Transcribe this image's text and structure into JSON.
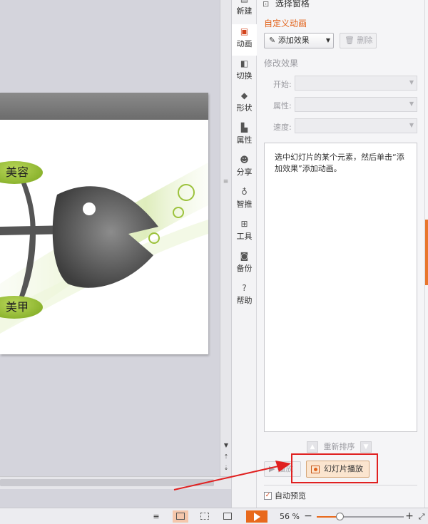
{
  "slide": {
    "bubble_top": "美容",
    "bubble_bottom": "美甲"
  },
  "side_tabs": [
    {
      "label": "新建",
      "icon": "new-icon"
    },
    {
      "label": "动画",
      "icon": "animation-icon"
    },
    {
      "label": "切换",
      "icon": "transition-icon"
    },
    {
      "label": "形状",
      "icon": "shape-icon"
    },
    {
      "label": "属性",
      "icon": "property-icon"
    },
    {
      "label": "分享",
      "icon": "share-icon"
    },
    {
      "label": "智推",
      "icon": "recommend-icon"
    },
    {
      "label": "工具",
      "icon": "toolbox-icon"
    },
    {
      "label": "备份",
      "icon": "backup-icon"
    },
    {
      "label": "帮助",
      "icon": "help-icon"
    }
  ],
  "active_tab": "动画",
  "pane": {
    "selection_pane": "选择窗格",
    "section_title": "自定义动画",
    "add_effect": "添加效果",
    "delete": "删除",
    "modify_title": "修改效果",
    "start_label": "开始:",
    "property_label": "属性:",
    "speed_label": "速度:",
    "hint": "选中幻灯片的某个元素，然后单击“添加效果”添加动画。",
    "reorder": "重新排序",
    "play": "播放",
    "slideshow": "幻灯片播放",
    "auto_preview": "自动预览",
    "auto_preview_checked": true
  },
  "status": {
    "zoom": "56 %",
    "zoom_minus": "−",
    "zoom_plus": "+",
    "zoom_level": 0.27
  },
  "colors": {
    "accent": "#e8691c",
    "title": "#e2641c",
    "highlight": "#e02020"
  }
}
